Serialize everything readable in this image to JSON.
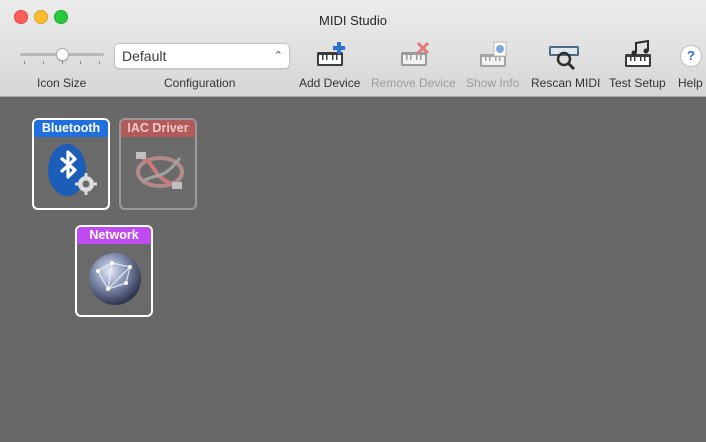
{
  "window": {
    "title": "MIDI Studio"
  },
  "toolbar": {
    "icon_size_label": "Icon Size",
    "configuration_label": "Configuration",
    "configuration_value": "Default",
    "add_device_label": "Add Device",
    "remove_device_label": "Remove Device",
    "show_info_label": "Show Info",
    "rescan_midi_label": "Rescan MIDI",
    "test_setup_label": "Test Setup",
    "help_label": "Help",
    "help_glyph": "?"
  },
  "devices": [
    {
      "label": "Bluetooth",
      "color": "#1f6fe0",
      "icon": "bluetooth-icon",
      "enabled": true
    },
    {
      "label": "IAC Driver",
      "color": "#d85a5a",
      "icon": "iac-driver-icon",
      "enabled": false
    },
    {
      "label": "Network",
      "color": "#c04bf0",
      "icon": "network-globe-icon",
      "enabled": true
    }
  ]
}
